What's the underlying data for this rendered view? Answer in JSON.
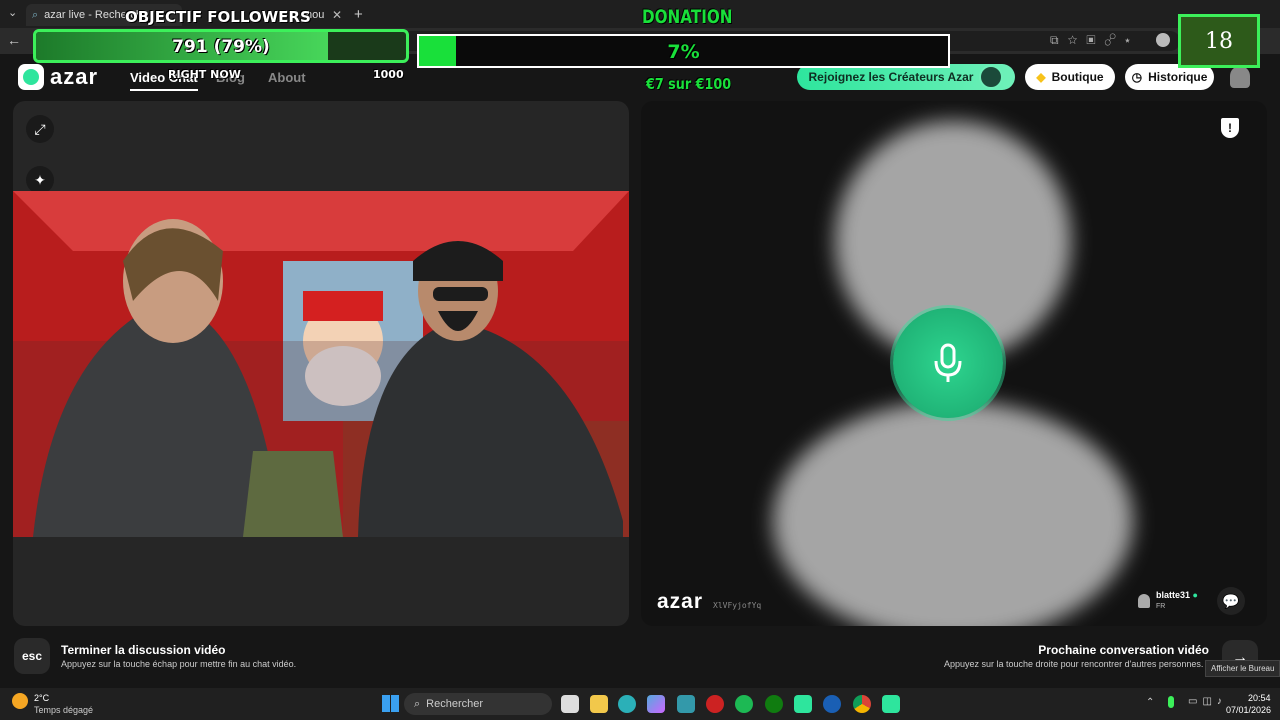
{
  "browser": {
    "tab_title": "azar live - Recherche",
    "tab2_fragment": "nou"
  },
  "azar": {
    "logo": "azar",
    "nav": [
      "Video Chat",
      "Blog",
      "About"
    ],
    "join_creators": "Rejoignez les Créateurs Azar",
    "shop": "Boutique",
    "history": "Historique",
    "watermark": "azar",
    "watermark_id": "XlVFyjofYq",
    "partner": {
      "name": "blatte31",
      "country": "FR"
    },
    "end_chat": {
      "title": "Terminer la discussion vidéo",
      "subtitle": "Appuyez sur la touche échap pour mettre fin au chat vidéo.",
      "key": "esc"
    },
    "next_chat": {
      "title": "Prochaine conversation vidéo",
      "subtitle": "Appuyez sur la touche droite pour rencontrer d'autres personnes."
    }
  },
  "overlay": {
    "followers_title": "OBJECTIF FOLLOWERS",
    "followers_value": "791 (79%)",
    "followers_progress": 0.79,
    "right_now": "RIGHT NOW",
    "right_now_count": "1000",
    "donation_title": "DONATION",
    "donation_percent": "7%",
    "donation_progress": 0.07,
    "donation_amount": "€7 sur €100",
    "counter": "18"
  },
  "taskbar": {
    "weather_temp": "2°C",
    "weather_desc": "Temps dégagé",
    "search": "Rechercher",
    "time": "20:54",
    "date": "07/01/2026",
    "tooltip": "Afficher le Bureau"
  },
  "colors": {
    "accent": "#2ee59d",
    "overlay_green": "#3cf05a"
  }
}
